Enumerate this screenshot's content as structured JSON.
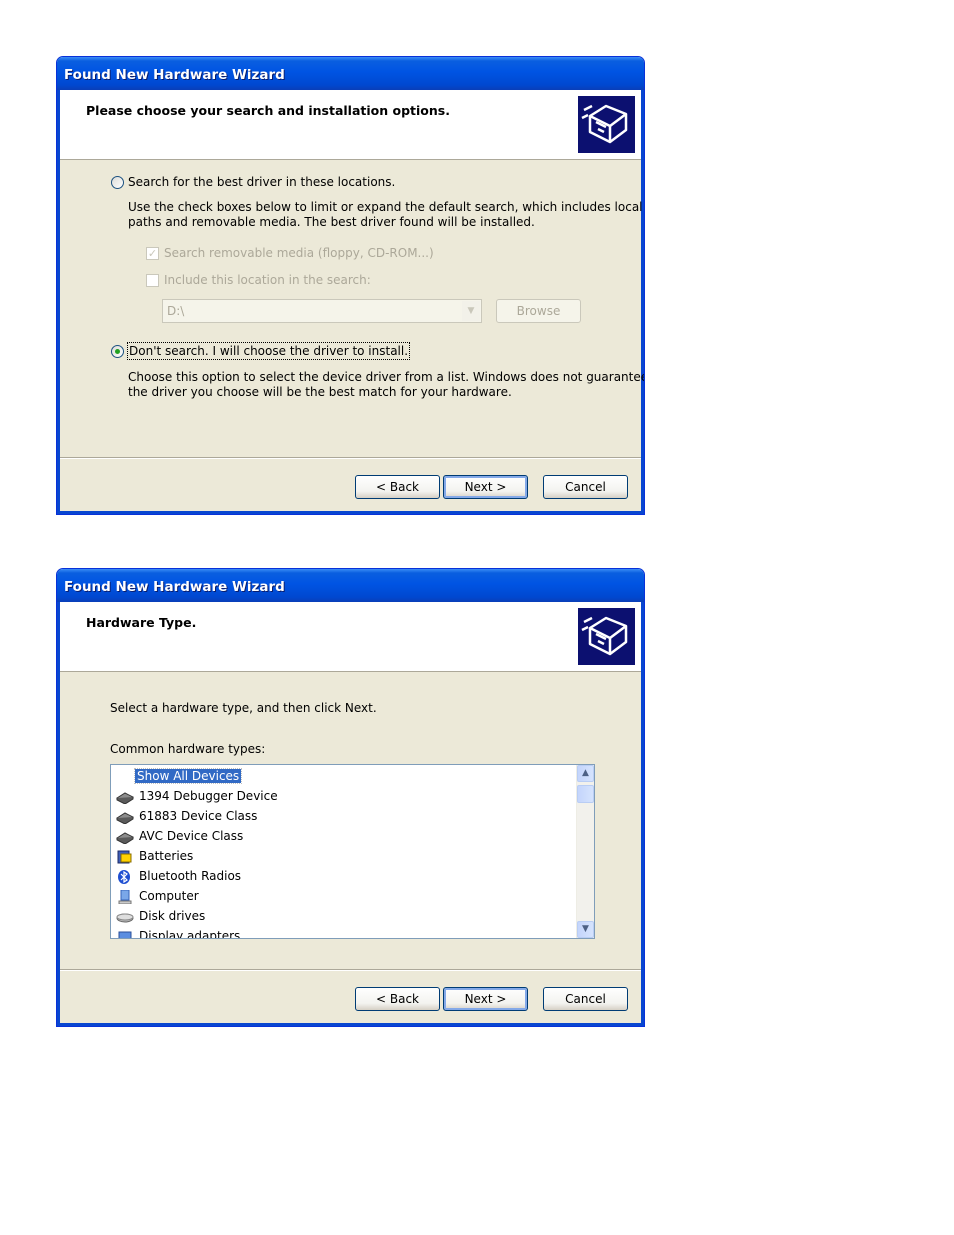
{
  "dialog1": {
    "title": "Found New Hardware Wizard",
    "header": "Please choose your search and installation options.",
    "option_search": {
      "label": "Search for the best driver in these locations.",
      "selected": false,
      "description_line1": "Use the check boxes below to limit or expand the default search, which includes local",
      "description_line2": "paths and removable media. The best driver found will be installed.",
      "checkbox_removable": {
        "label": "Search removable media (floppy, CD-ROM...)",
        "checked": true,
        "enabled": false
      },
      "checkbox_location": {
        "label": "Include this location in the search:",
        "checked": false,
        "enabled": false
      },
      "location_value": "D:\\",
      "browse_label": "Browse"
    },
    "option_choose": {
      "label": "Don't search. I will choose the driver to install.",
      "selected": true,
      "description_line1": "Choose this option to select the device driver from a list.  Windows does not guarantee that",
      "description_line2": "the driver you choose will be the best match for your hardware."
    },
    "buttons": {
      "back": "< Back",
      "next": "Next >",
      "cancel": "Cancel"
    }
  },
  "dialog2": {
    "title": "Found New Hardware Wizard",
    "header": "Hardware Type.",
    "instruction": "Select a hardware type, and then click Next.",
    "list_label": "Common hardware types:",
    "items": [
      {
        "label": "Show All Devices",
        "icon": "none",
        "selected": true
      },
      {
        "label": "1394 Debugger Device",
        "icon": "device-icon",
        "selected": false
      },
      {
        "label": "61883 Device Class",
        "icon": "device-icon",
        "selected": false
      },
      {
        "label": "AVC Device Class",
        "icon": "device-icon",
        "selected": false
      },
      {
        "label": "Batteries",
        "icon": "battery-icon",
        "selected": false
      },
      {
        "label": "Bluetooth Radios",
        "icon": "bluetooth-icon",
        "selected": false
      },
      {
        "label": "Computer",
        "icon": "computer-icon",
        "selected": false
      },
      {
        "label": "Disk drives",
        "icon": "disk-icon",
        "selected": false
      },
      {
        "label": "Display adapters",
        "icon": "display-icon",
        "selected": false
      }
    ],
    "buttons": {
      "back": "< Back",
      "next": "Next >",
      "cancel": "Cancel"
    }
  },
  "colors": {
    "titlebar": "#0054e3",
    "dialog_bg": "#ece9d8",
    "selection": "#316ac5",
    "radio_dot": "#21a121"
  }
}
